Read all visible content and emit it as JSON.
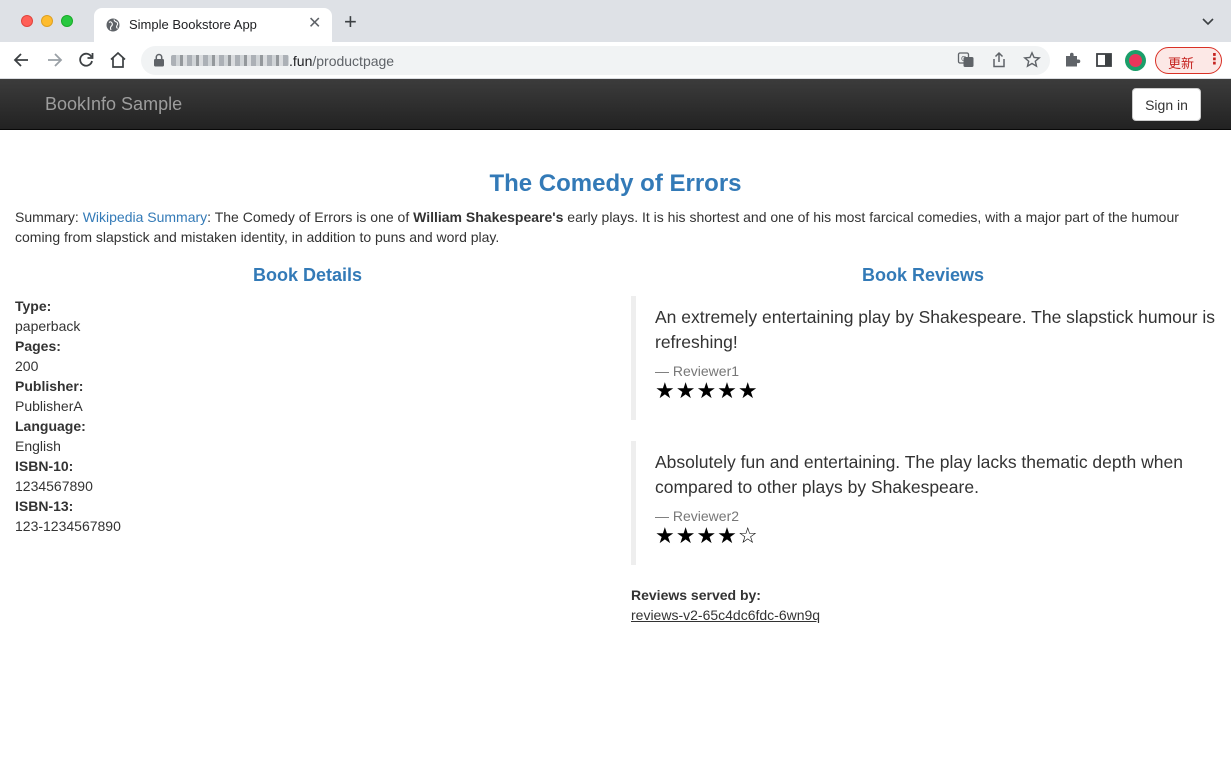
{
  "browser": {
    "tab_title": "Simple Bookstore App",
    "tab_close": "✕",
    "new_tab": "+",
    "url_domain": ".fun",
    "url_path": "/productpage",
    "update_label": "更新",
    "update_menu": "⋮"
  },
  "navbar": {
    "brand": "BookInfo Sample",
    "signin_label": "Sign in"
  },
  "book": {
    "title": "The Comedy of Errors",
    "summary_prefix": "Summary: ",
    "summary_link": "Wikipedia Summary",
    "summary_part1": ": The Comedy of Errors is one of ",
    "summary_bold": "William Shakespeare's",
    "summary_part2": " early plays. It is his shortest and one of his most farcical comedies, with a major part of the humour coming from slapstick and mistaken identity, in addition to puns and word play."
  },
  "details": {
    "heading": "Book Details",
    "fields": [
      {
        "label": "Type:",
        "value": "paperback"
      },
      {
        "label": "Pages:",
        "value": "200"
      },
      {
        "label": "Publisher:",
        "value": "PublisherA"
      },
      {
        "label": "Language:",
        "value": "English"
      },
      {
        "label": "ISBN-10:",
        "value": "1234567890"
      },
      {
        "label": "ISBN-13:",
        "value": "123-1234567890"
      }
    ]
  },
  "reviews": {
    "heading": "Book Reviews",
    "items": [
      {
        "text": "An extremely entertaining play by Shakespeare. The slapstick humour is refreshing!",
        "reviewer": "— Reviewer1",
        "stars": "★★★★★",
        "rating": 5
      },
      {
        "text": "Absolutely fun and entertaining. The play lacks thematic depth when compared to other plays by Shakespeare.",
        "reviewer": "— Reviewer2",
        "stars": "★★★★☆",
        "rating": 4
      }
    ],
    "served_by_label": "Reviews served by:",
    "served_by_value": "reviews-v2-65c4dc6fdc-6wn9q"
  }
}
